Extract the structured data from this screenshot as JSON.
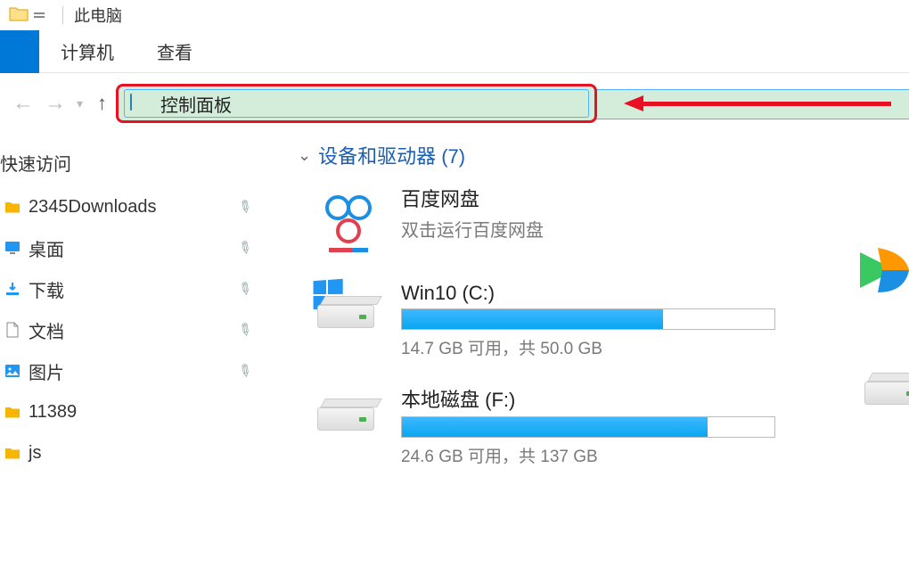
{
  "title": "此电脑",
  "ribbon": {
    "tab_computer": "计算机",
    "tab_view": "查看"
  },
  "address": {
    "text": "控制面板"
  },
  "sidebar": {
    "header": "快速访问",
    "items": [
      {
        "label": "2345Downloads",
        "icon": "folder",
        "color": "#f7b500"
      },
      {
        "label": "桌面",
        "icon": "desktop",
        "color": "#2196f3"
      },
      {
        "label": "下载",
        "icon": "download",
        "color": "#2196f3"
      },
      {
        "label": "文档",
        "icon": "document",
        "color": "#555"
      },
      {
        "label": "图片",
        "icon": "pictures",
        "color": "#2196f3"
      },
      {
        "label": "11389",
        "icon": "folder",
        "color": "#f7b500"
      },
      {
        "label": "js",
        "icon": "folder",
        "color": "#f7b500"
      }
    ]
  },
  "content": {
    "group_header": "设备和驱动器 (7)",
    "baidu": {
      "title": "百度网盘",
      "subtitle": "双击运行百度网盘"
    },
    "drive_c": {
      "title": "Win10 (C:)",
      "usage_text": "14.7 GB 可用，共 50.0 GB",
      "fill_percent": 70
    },
    "drive_f": {
      "title": "本地磁盘 (F:)",
      "usage_text": "24.6 GB 可用，共 137 GB",
      "fill_percent": 82
    }
  }
}
